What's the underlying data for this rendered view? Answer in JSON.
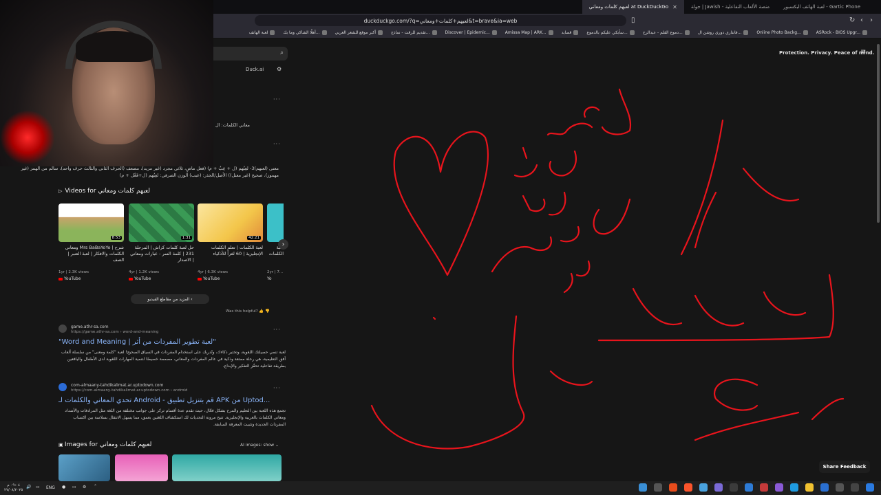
{
  "tabs": [
    {
      "label": "لعبة الهاتف البكسبور - Gartic Phone",
      "active": false
    },
    {
      "label": "جولة | Jawish - منصة الألعاب التفاعلية",
      "active": false
    },
    {
      "label": "لعبهم كلمات ومعاني at DuckDuckGo",
      "active": true
    }
  ],
  "address": {
    "url": "duckduckgo.com/?q=لعبهم+كلمات+ومعاني&t=brave&ia=web"
  },
  "bookmarks": [
    "لعبة الهاتف",
    "أهلًا الشاكي وما بك...",
    "أكبر موقع للشعر العربي",
    "تقديم للرقت - نماذج...",
    "Discover | Epidemic...",
    "Amissa Map | ARK...",
    "قصايد",
    "سأبكي عليكم بالدموع...",
    "دموع القلم - عبدالرح...",
    "فانتاري دوري روشن ال...",
    "Online Photo Backg...",
    "ASRock - BIOS Upgr..."
  ],
  "search": {
    "duck_ai": "Duck.ai",
    "tagline": "Protection. Privacy. Peace of mind."
  },
  "snippets": {
    "snip1": "معاني الكلمات: ال",
    "snip2": "معنى (لعبهم)3- لعِبُهم (ل + عِبٌ + م) (فعل ماضٍ، ثلاثي مجرد (غير مزيد)، مضعف (الحرف الثاني والثالث حرف واحد)، سالم من الهمز (غير مهموز)، صحيح (غير معتل)) الأصل/الجذر: (عبب) الوزن الصرفي: لعِبُهم (ل+فَعْل + م)"
  },
  "videos": {
    "header": "Videos for لعبهم كلمات ومعاني",
    "items": [
      {
        "title": "شرح | Mrs BaBaYoYo ومعاني الكلمات والافكار | لعبة العنبر | الصف",
        "duration": "8:53",
        "meta": "1yr | 2.3K views",
        "source": "YouTube",
        "color": "#d6e8c8"
      },
      {
        "title": "حل لعبة كلمات كراش | المرحلة 231 | كلمة السر - عبارات ومعاني | الاصدار",
        "duration": "1:31",
        "meta": "4yr | 1.2K views",
        "source": "YouTube",
        "color": "#3a9a55"
      },
      {
        "title": "لعبة الكلمات | تعلم الكلمات الإنجليزية | 60 لغزاً للأذكياء",
        "duration": "42:21",
        "meta": "4yr | 6.3K views",
        "source": "YouTube",
        "color": "#f3c64a"
      },
      {
        "title": "لعبة الكلمات",
        "duration": "",
        "meta": "2yr | 7...",
        "source": "Yo",
        "color": "#3cc0c8"
      }
    ],
    "more": "المزيد من مقاطع الفيديو",
    "helpful": "Was this helpful?"
  },
  "results": [
    {
      "site": "game.athr-sa.com",
      "url": "https://game.athr-sa.com › word-and-meaning",
      "title": "\"Word and Meaning | لعبة تطوير المفردات من أثر\"",
      "snippet": "لعبة تنمي حصيلتك اللغوية، وتختبر ذكاءك، وتُدربك على استخدام المفردات في السياق الصحيح! لعبة \"كلمة ومعنى\" من سلسلة ألعاب أفق التعليمية، هي رحلة ممتعة وذكية في عالم المفردات والمعاني، مصممة خصيصًا لتنمية المهارات اللغوية لدى الأطفال واليافعين بطريقة تفاعلية تحفّز التفكير والإبداع."
    },
    {
      "site": "com-almaany-tahdikalimat.ar.uptodown.com",
      "url": "https://com-almaany-tahdikalimat.ar.uptodown.com › android",
      "title": "تحدي المعاني والكلمات لـ Android - قم بتنزيل تطبيق APK من Uptod...",
      "snippet": "تجمع هذه اللعبة بين التعليم والمرح بشكل فعّال، حيث تقدم عدة أقسام تركز على جوانب مختلفة من اللغة مثل المرادفات والأضداد ومعاني الكلمات بالعربية والإنجليزية. تتيح مرونة التحديات لك استكشاف اللغتين بعمق، مما يسهل الانتقال بسلاسة بين اكتساب المفردات الجديدة وتثبيت المعرفة السابقة."
    }
  ],
  "images": {
    "header": "Images for لعبهم كلمات ومعاني",
    "ai": "AI images: show"
  },
  "feedback": "Share Feedback",
  "taskbar": {
    "time": "٠٩:٠٤ م",
    "date": "٢٧/٠٨/٢٠٢٥",
    "lang": "ENG"
  }
}
